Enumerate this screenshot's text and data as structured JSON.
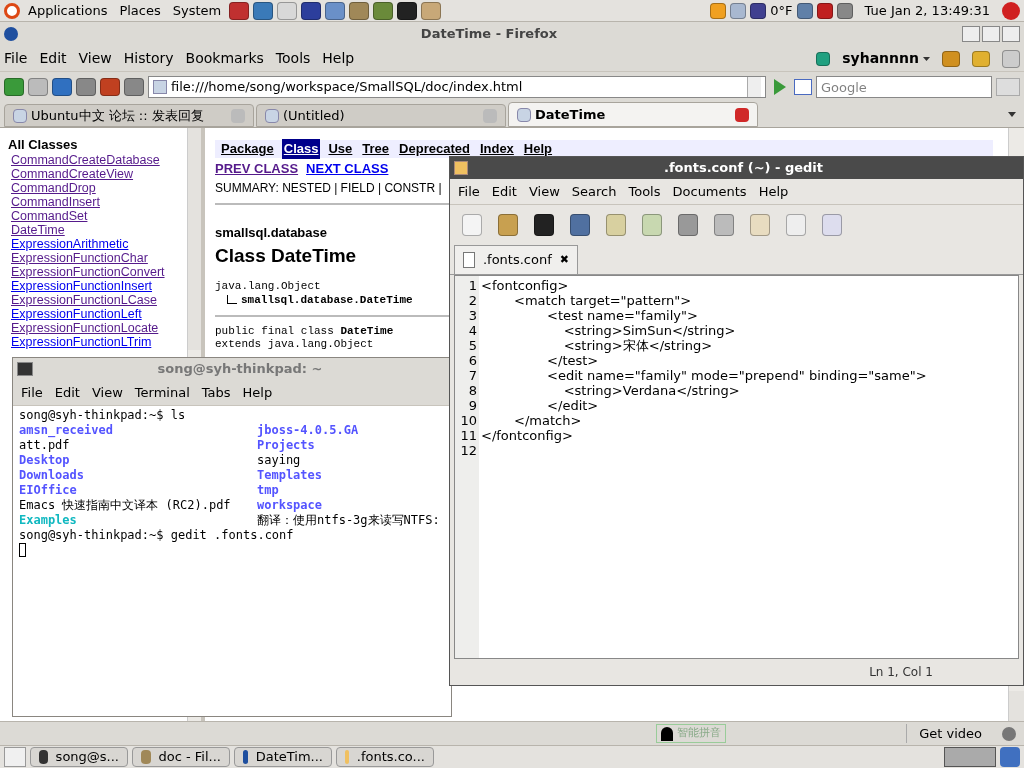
{
  "top_panel": {
    "menus": [
      "Applications",
      "Places",
      "System"
    ],
    "weather": "0°F",
    "clock": "Tue Jan  2, 13:49:31"
  },
  "firefox": {
    "title": "DateTime - Firefox",
    "menus": [
      "File",
      "Edit",
      "View",
      "History",
      "Bookmarks",
      "Tools",
      "Help"
    ],
    "account": "syhannnn",
    "url": "file:///home/song/workspace/SmallSQL/doc/index.html",
    "search_placeholder": "Google",
    "tabs": [
      {
        "label": "Ubuntu中文 论坛 :: 发表回复",
        "selected": false
      },
      {
        "label": "(Untitled)",
        "selected": false
      },
      {
        "label": "DateTime",
        "selected": true
      }
    ],
    "class_list": {
      "heading": "All Classes",
      "items": [
        {
          "label": "CommandCreateDatabase",
          "visited": true
        },
        {
          "label": "CommandCreateView",
          "visited": true
        },
        {
          "label": "CommandDrop",
          "visited": true
        },
        {
          "label": "CommandInsert",
          "visited": true
        },
        {
          "label": "CommandSet",
          "visited": true
        },
        {
          "label": "DateTime",
          "visited": true
        },
        {
          "label": "ExpressionArithmetic",
          "visited": false
        },
        {
          "label": "ExpressionFunctionChar",
          "visited": true
        },
        {
          "label": "ExpressionFunctionConvert",
          "visited": true
        },
        {
          "label": "ExpressionFunctionInsert",
          "visited": false
        },
        {
          "label": "ExpressionFunctionLCase",
          "visited": true
        },
        {
          "label": "ExpressionFunctionLeft",
          "visited": false
        },
        {
          "label": "ExpressionFunctionLocate",
          "visited": true
        },
        {
          "label": "ExpressionFunctionLTrim",
          "visited": false
        }
      ]
    },
    "doc": {
      "nav": [
        {
          "label": "Package",
          "selected": false
        },
        {
          "label": "Class",
          "selected": true
        },
        {
          "label": "Use",
          "selected": false
        },
        {
          "label": "Tree",
          "selected": false
        },
        {
          "label": "Deprecated",
          "selected": false
        },
        {
          "label": "Index",
          "selected": false
        },
        {
          "label": "Help",
          "selected": false
        }
      ],
      "prev": "PREV CLASS",
      "next": "NEXT CLASS",
      "summary": "SUMMARY: NESTED | FIELD | CONSTR |",
      "package": "smallsql.database",
      "class_title": "Class DateTime",
      "hierarchy": [
        "java.lang.Object",
        "smallsql.database.DateTime"
      ],
      "declaration": [
        "public final class **DateTime**",
        "extends java.lang.Object"
      ]
    },
    "status": {
      "ime": "智能拼音",
      "get_video": "Get video"
    }
  },
  "terminal": {
    "title": "song@syh-thinkpad: ~",
    "menus": [
      "File",
      "Edit",
      "View",
      "Terminal",
      "Tabs",
      "Help"
    ],
    "command_1": "song@syh-thinkpad:~$ ls",
    "listing": [
      [
        {
          "name": "amsn_received",
          "kind": "dir"
        },
        {
          "name": "jboss-4.0.5.GA",
          "kind": "dir"
        }
      ],
      [
        {
          "name": "att.pdf",
          "kind": "file"
        },
        {
          "name": "Projects",
          "kind": "dir"
        }
      ],
      [
        {
          "name": "Desktop",
          "kind": "dir"
        },
        {
          "name": "saying",
          "kind": "file"
        }
      ],
      [
        {
          "name": "Downloads",
          "kind": "dir"
        },
        {
          "name": "Templates",
          "kind": "dir"
        }
      ],
      [
        {
          "name": "EIOffice",
          "kind": "dir"
        },
        {
          "name": "tmp",
          "kind": "dir"
        }
      ],
      [
        {
          "name": "Emacs 快速指南中文译本 (RC2).pdf",
          "kind": "file"
        },
        {
          "name": "workspace",
          "kind": "dir"
        }
      ],
      [
        {
          "name": "Examples",
          "kind": "link"
        },
        {
          "name": "翻译：使用ntfs-3g来读写NTFS:",
          "kind": "file"
        }
      ]
    ],
    "command_2": "song@syh-thinkpad:~$ gedit .fonts.conf"
  },
  "gedit": {
    "title": ".fonts.conf (~) - gedit",
    "menus": [
      "File",
      "Edit",
      "View",
      "Search",
      "Tools",
      "Documents",
      "Help"
    ],
    "tab": ".fonts.conf",
    "tab_close": "✖",
    "lines": [
      {
        "number": "1",
        "text": "<fontconfig>"
      },
      {
        "number": "2",
        "text": "        <match target=\"pattern\">"
      },
      {
        "number": "3",
        "text": "                <test name=\"family\">"
      },
      {
        "number": "4",
        "text": "                    <string>SimSun</string>"
      },
      {
        "number": "5",
        "text": "                    <string>宋体</string>"
      },
      {
        "number": "6",
        "text": "                </test>"
      },
      {
        "number": "7",
        "text": "                <edit name=\"family\" mode=\"prepend\" binding=\"same\">"
      },
      {
        "number": "8",
        "text": "                    <string>Verdana</string>"
      },
      {
        "number": "9",
        "text": "                </edit>"
      },
      {
        "number": "10",
        "text": "        </match>"
      },
      {
        "number": "11",
        "text": "</fontconfig>"
      },
      {
        "number": "12"
      }
    ],
    "status": "Ln 1, Col 1"
  },
  "taskbar": [
    "song@s...",
    "doc - Fil...",
    "DateTim...",
    ".fonts.co..."
  ]
}
